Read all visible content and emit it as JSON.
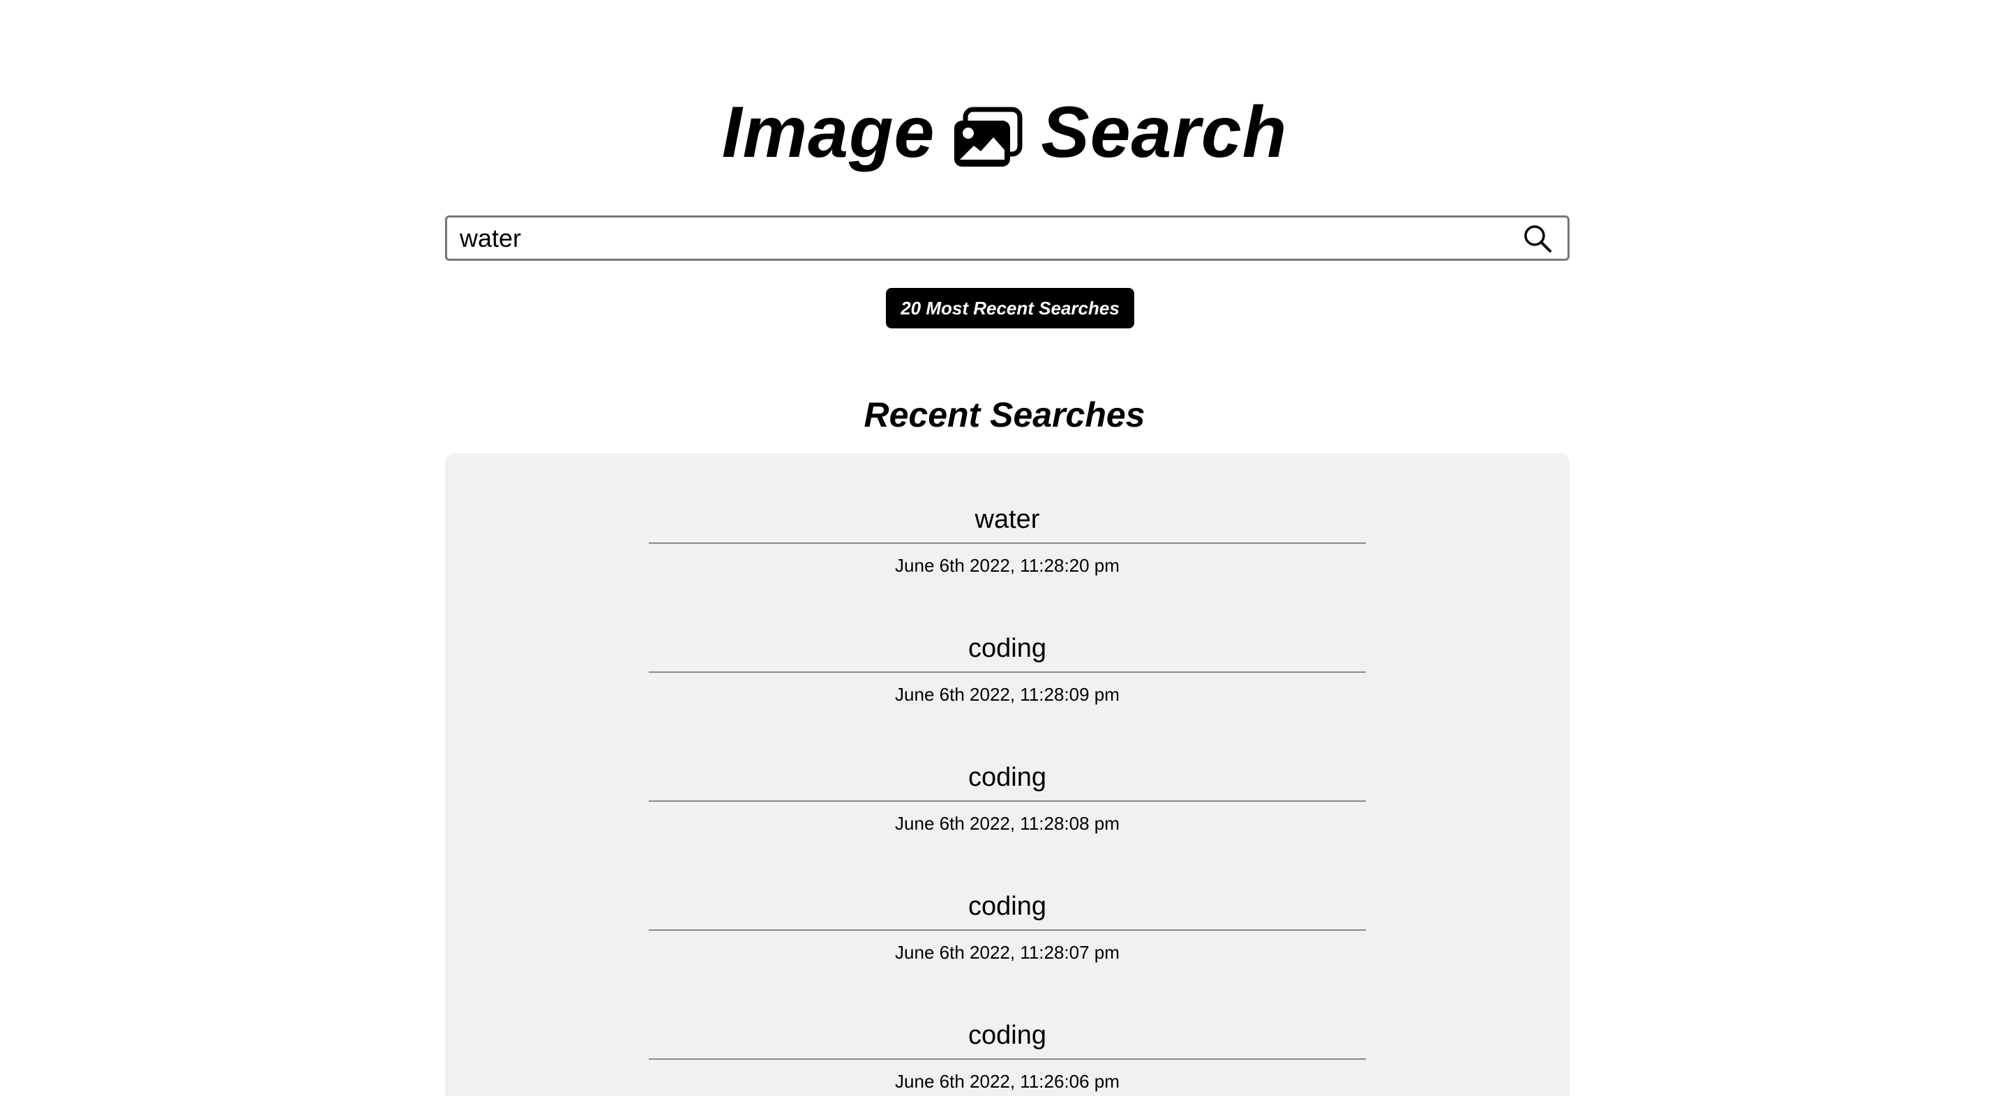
{
  "header": {
    "title_left": "Image",
    "title_right": "Search",
    "logo_icon": "images-icon"
  },
  "search": {
    "value": "water",
    "placeholder": "",
    "icon": "search-icon"
  },
  "recent_button_label": "20 Most Recent Searches",
  "recent": {
    "heading": "Recent Searches",
    "items": [
      {
        "query": "water",
        "time": "June 6th 2022, 11:28:20 pm"
      },
      {
        "query": "coding",
        "time": "June 6th 2022, 11:28:09 pm"
      },
      {
        "query": "coding",
        "time": "June 6th 2022, 11:28:08 pm"
      },
      {
        "query": "coding",
        "time": "June 6th 2022, 11:28:07 pm"
      },
      {
        "query": "coding",
        "time": "June 6th 2022, 11:26:06 pm"
      }
    ]
  }
}
